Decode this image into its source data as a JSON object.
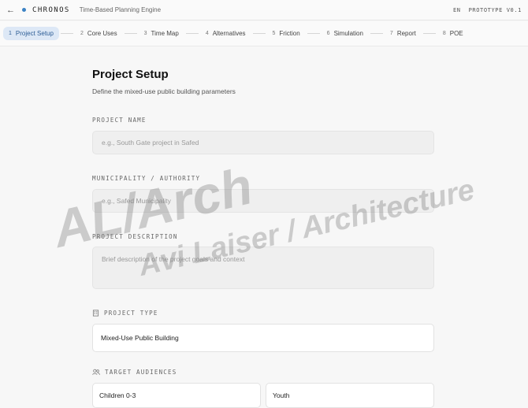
{
  "header": {
    "brand": "CHRONOS",
    "subtitle": "Time-Based Planning Engine",
    "language": "EN",
    "version": "PROTOTYPE V0.1"
  },
  "steps": [
    {
      "num": "1",
      "label": "Project Setup"
    },
    {
      "num": "2",
      "label": "Core Uses"
    },
    {
      "num": "3",
      "label": "Time Map"
    },
    {
      "num": "4",
      "label": "Alternatives"
    },
    {
      "num": "5",
      "label": "Friction"
    },
    {
      "num": "6",
      "label": "Simulation"
    },
    {
      "num": "7",
      "label": "Report"
    },
    {
      "num": "8",
      "label": "POE"
    }
  ],
  "page": {
    "title": "Project Setup",
    "description": "Define the mixed-use public building parameters"
  },
  "form": {
    "project_name": {
      "label": "PROJECT NAME",
      "placeholder": "e.g., South Gate project in Safed"
    },
    "municipality": {
      "label": "MUNICIPALITY / AUTHORITY",
      "placeholder": "e.g., Safed Municipality"
    },
    "description": {
      "label": "PROJECT DESCRIPTION",
      "placeholder": "Brief description of the project goals and context"
    },
    "project_type": {
      "label": "PROJECT TYPE",
      "value": "Mixed-Use Public Building"
    },
    "audiences": {
      "label": "TARGET AUDIENCES",
      "options": [
        "Children 0-3",
        "Youth"
      ]
    }
  },
  "watermark": {
    "line1": "AL/Arch",
    "line2": "Avi Laiser / Architecture"
  },
  "colors": {
    "accent": "#3b82c4",
    "active_step_bg": "#dde8f6",
    "background": "#f7f7f7"
  }
}
